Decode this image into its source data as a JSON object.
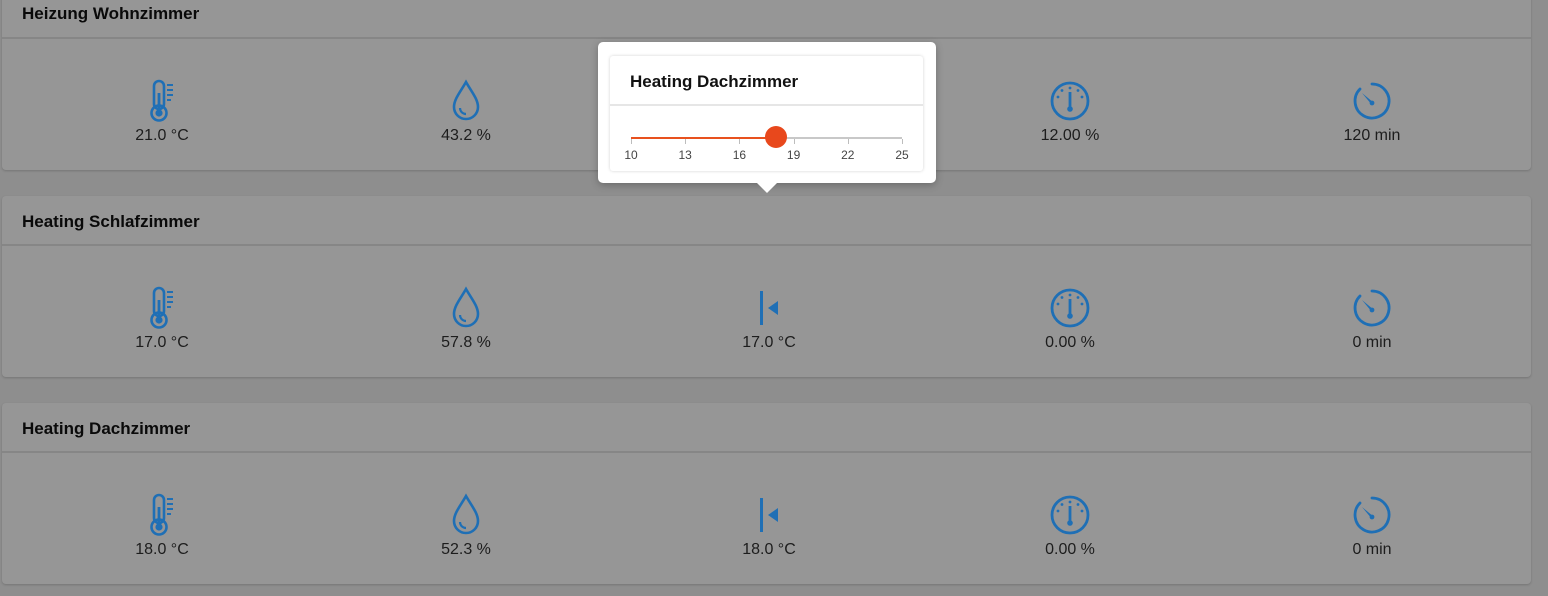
{
  "colors": {
    "icon": "#1f6fb5",
    "accent": "#e8481c"
  },
  "cards": [
    {
      "title": "Heizung Wohnzimmer",
      "items": [
        {
          "icon": "thermometer-icon",
          "value": "21.0 °C"
        },
        {
          "icon": "water-drop-icon",
          "value": "43.2 %"
        },
        {
          "icon": "setpoint-icon",
          "value": ""
        },
        {
          "icon": "valve-gauge-icon",
          "value": "12.00 %"
        },
        {
          "icon": "timer-icon",
          "value": "120 min"
        }
      ]
    },
    {
      "title": "Heating Schlafzimmer",
      "items": [
        {
          "icon": "thermometer-icon",
          "value": "17.0 °C"
        },
        {
          "icon": "water-drop-icon",
          "value": "57.8 %"
        },
        {
          "icon": "setpoint-icon",
          "value": "17.0 °C"
        },
        {
          "icon": "valve-gauge-icon",
          "value": "0.00 %"
        },
        {
          "icon": "timer-icon",
          "value": "0 min"
        }
      ]
    },
    {
      "title": "Heating Dachzimmer",
      "items": [
        {
          "icon": "thermometer-icon",
          "value": "18.0 °C"
        },
        {
          "icon": "water-drop-icon",
          "value": "52.3 %"
        },
        {
          "icon": "setpoint-icon",
          "value": "18.0 °C"
        },
        {
          "icon": "valve-gauge-icon",
          "value": "0.00 %"
        },
        {
          "icon": "timer-icon",
          "value": "0 min"
        }
      ]
    }
  ],
  "popup": {
    "title": "Heating Dachzimmer",
    "slider": {
      "min": 10,
      "max": 25,
      "value": 18,
      "ticks": [
        "10",
        "13",
        "16",
        "19",
        "22",
        "25"
      ]
    }
  }
}
